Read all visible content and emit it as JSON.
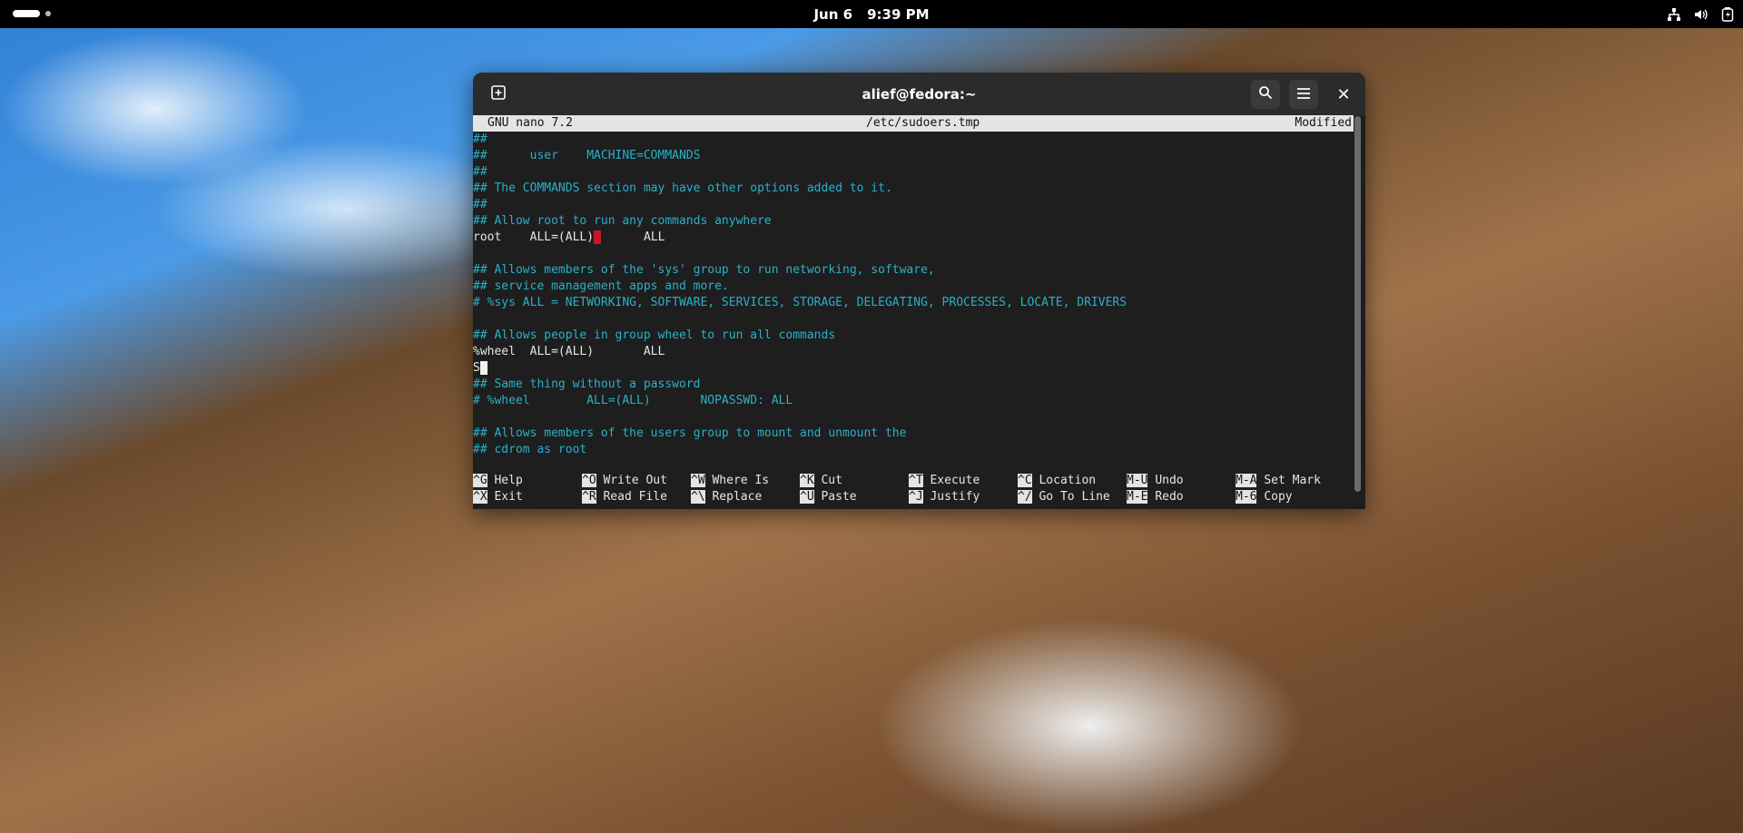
{
  "topbar": {
    "date": "Jun 6",
    "time": "9:39 PM",
    "icons": [
      "activities-indicator",
      "network-icon",
      "volume-icon",
      "battery-icon"
    ]
  },
  "terminal": {
    "title": "alief@fedora:~",
    "icons": [
      "new-tab-icon",
      "search-icon",
      "menu-icon",
      "close-icon"
    ],
    "close_glyph": "✕"
  },
  "nano": {
    "version": "GNU nano 7.2",
    "filename": "/etc/sudoers.tmp",
    "status": "Modified",
    "lines": [
      {
        "text": "##",
        "style": "comment"
      },
      {
        "text": "##      user    MACHINE=COMMANDS",
        "style": "comment"
      },
      {
        "text": "##",
        "style": "comment"
      },
      {
        "text": "## The COMMANDS section may have other options added to it.",
        "style": "comment"
      },
      {
        "text": "##",
        "style": "comment"
      },
      {
        "text": "## Allow root to run any commands anywhere",
        "style": "comment"
      },
      {
        "text": "root    ALL=(ALL)",
        "after": "      ALL",
        "style": "plain",
        "marker": "red"
      },
      {
        "text": "",
        "style": "plain"
      },
      {
        "text": "## Allows members of the 'sys' group to run networking, software,",
        "style": "comment"
      },
      {
        "text": "## service management apps and more.",
        "style": "comment"
      },
      {
        "text": "# %sys ALL = NETWORKING, SOFTWARE, SERVICES, STORAGE, DELEGATING, PROCESSES, LOCATE, DRIVERS",
        "style": "comment"
      },
      {
        "text": "",
        "style": "plain"
      },
      {
        "text": "## Allows people in group wheel to run all commands",
        "style": "comment"
      },
      {
        "text": "%wheel  ALL=(ALL)       ALL",
        "style": "plain"
      },
      {
        "text": "S",
        "style": "plain",
        "marker": "cursor"
      },
      {
        "text": "## Same thing without a password",
        "style": "comment"
      },
      {
        "text": "# %wheel        ALL=(ALL)       NOPASSWD: ALL",
        "style": "comment"
      },
      {
        "text": "",
        "style": "plain"
      },
      {
        "text": "## Allows members of the users group to mount and unmount the",
        "style": "comment"
      },
      {
        "text": "## cdrom as root",
        "style": "comment"
      }
    ],
    "shortcuts_row1": [
      {
        "key": "^G",
        "label": "Help"
      },
      {
        "key": "^O",
        "label": "Write Out"
      },
      {
        "key": "^W",
        "label": "Where Is"
      },
      {
        "key": "^K",
        "label": "Cut"
      },
      {
        "key": "^T",
        "label": "Execute"
      },
      {
        "key": "^C",
        "label": "Location"
      },
      {
        "key": "M-U",
        "label": "Undo"
      },
      {
        "key": "M-A",
        "label": "Set Mark"
      }
    ],
    "shortcuts_row2": [
      {
        "key": "^X",
        "label": "Exit"
      },
      {
        "key": "^R",
        "label": "Read File"
      },
      {
        "key": "^\\",
        "label": "Replace"
      },
      {
        "key": "^U",
        "label": "Paste"
      },
      {
        "key": "^J",
        "label": "Justify"
      },
      {
        "key": "^/",
        "label": "Go To Line"
      },
      {
        "key": "M-E",
        "label": "Redo"
      },
      {
        "key": "M-6",
        "label": "Copy"
      }
    ]
  }
}
